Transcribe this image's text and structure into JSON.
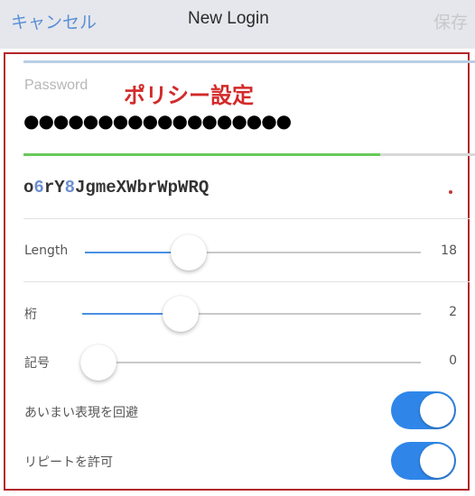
{
  "navbar": {
    "cancel_label": "キャンセル",
    "title": "New Login",
    "save_label": "保存"
  },
  "annotation": {
    "label": "ポリシー設定",
    "frame_color": "#b3262a"
  },
  "password": {
    "label": "Password",
    "masked_value": "●●●●●●●●●●●●●●●●●●",
    "strength": 0.79,
    "strength_color": "#68c95b"
  },
  "generated": {
    "parts": [
      {
        "text": "o",
        "digit": false
      },
      {
        "text": "6",
        "digit": true
      },
      {
        "text": "rY",
        "digit": false
      },
      {
        "text": "8",
        "digit": true
      },
      {
        "text": "JgmeXWbrWpWRQ",
        "digit": false
      }
    ]
  },
  "sliders": [
    {
      "label": "Length",
      "value": "18",
      "position": 0.31
    },
    {
      "label": "桁",
      "value": "2",
      "position": 0.29
    },
    {
      "label": "記号",
      "value": "0",
      "position": 0.0
    }
  ],
  "toggles": [
    {
      "label": "あいまい表現を回避",
      "on": true
    },
    {
      "label": "リピートを許可",
      "on": true
    }
  ],
  "colors": {
    "accent": "#4a90e2",
    "toggle_on": "#2f86e8",
    "annotation": "#d32a2a"
  }
}
